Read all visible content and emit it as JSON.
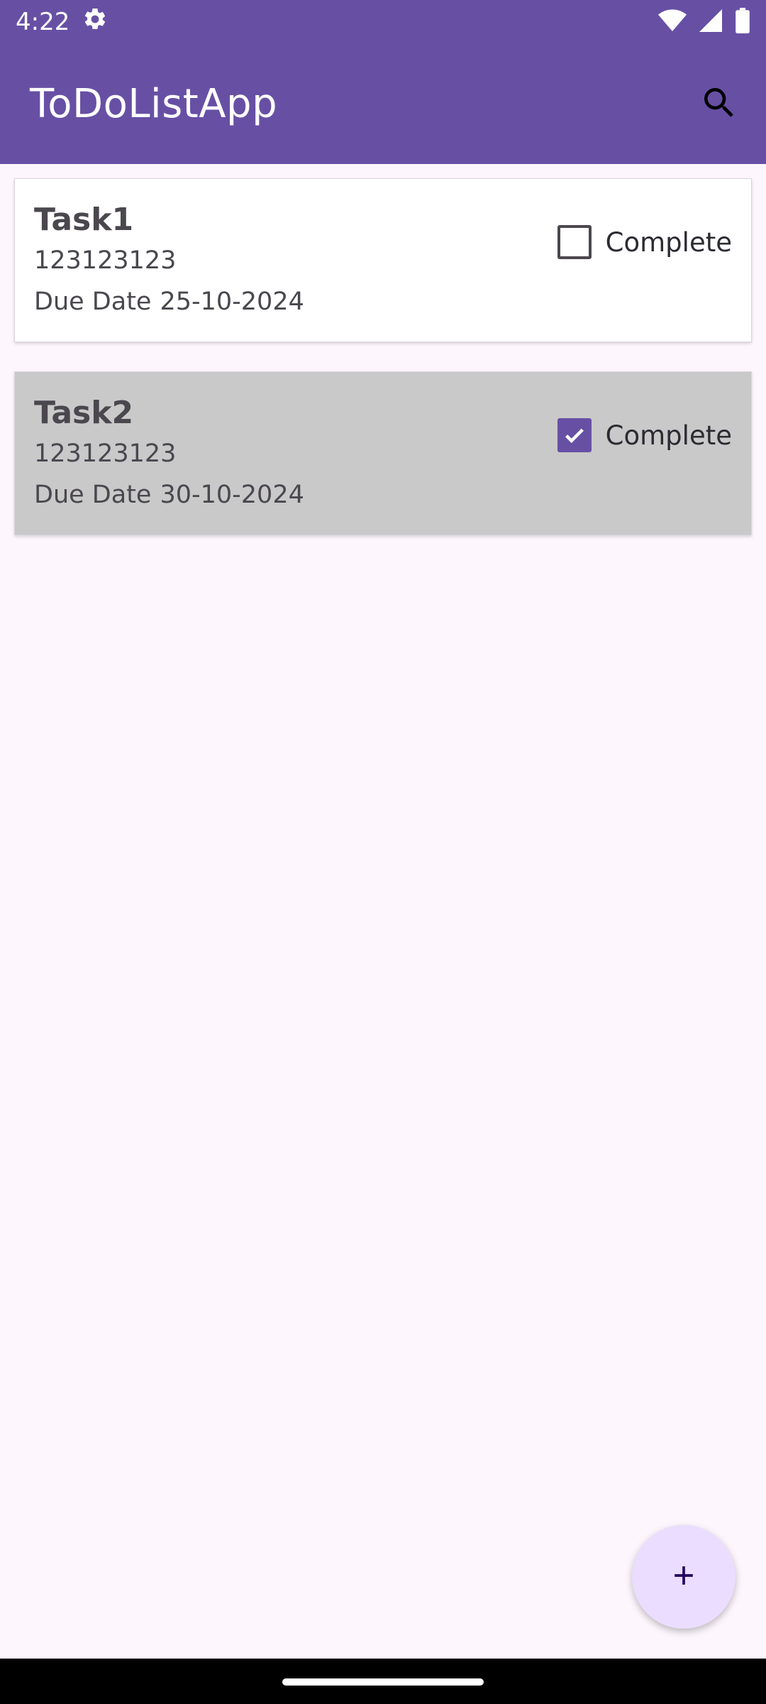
{
  "status_bar": {
    "time": "4:22",
    "icons": [
      "settings-icon",
      "wifi-icon",
      "signal-icon",
      "battery-icon"
    ]
  },
  "app_bar": {
    "title": "ToDoListApp",
    "search_icon": "search-icon"
  },
  "tasks": [
    {
      "name": "Task1",
      "description": "123123123",
      "due_label": "Due Date",
      "due_date": "25-10-2024",
      "complete_label": "Complete",
      "completed": false
    },
    {
      "name": "Task2",
      "description": "123123123",
      "due_label": "Due Date",
      "due_date": "30-10-2024",
      "complete_label": "Complete",
      "completed": true
    }
  ],
  "fab": {
    "icon": "plus-icon"
  },
  "colors": {
    "primary": "#6750a4",
    "background": "#fdf6fd",
    "completed_card": "#c9c9c9",
    "fab": "#eaddff"
  }
}
